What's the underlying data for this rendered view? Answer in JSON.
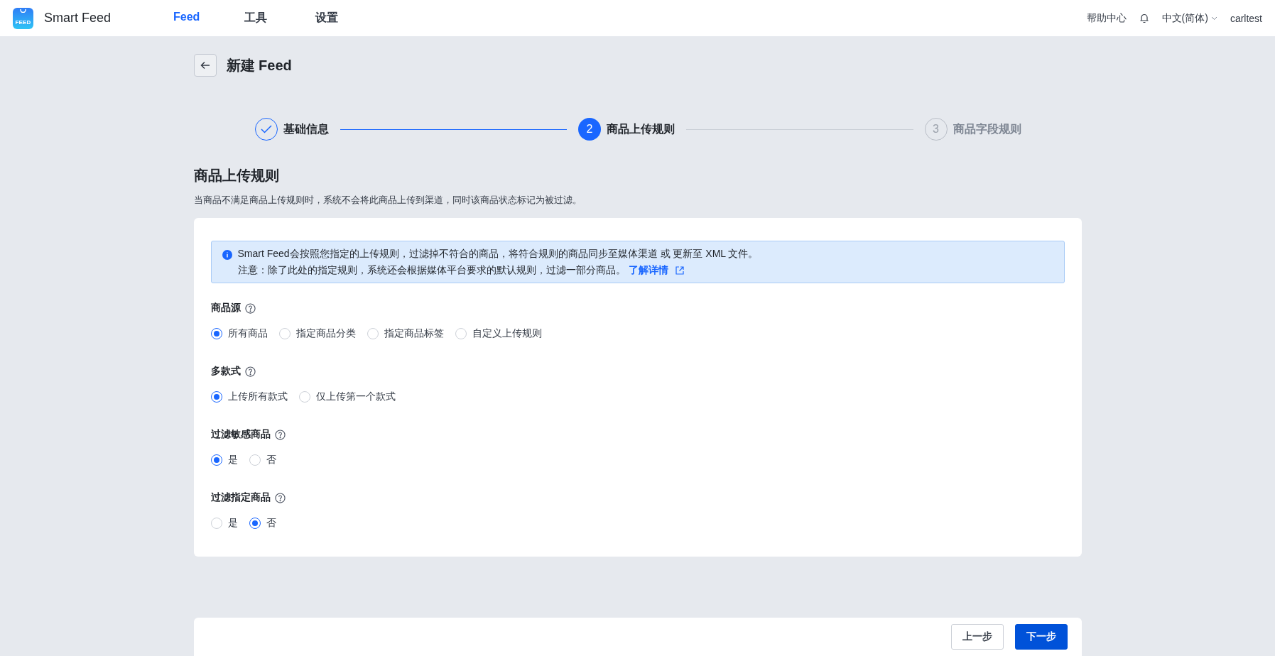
{
  "header": {
    "logo_text": "FEED",
    "app_name": "Smart Feed",
    "nav": [
      {
        "label": "Feed",
        "selected": true
      },
      {
        "label": "工具",
        "selected": false
      },
      {
        "label": "设置",
        "selected": false
      }
    ],
    "help": "帮助中心",
    "language": "中文(简体)",
    "user": "carltest"
  },
  "page": {
    "title": "新建 Feed"
  },
  "steps": [
    {
      "label": "基础信息",
      "kind": "done"
    },
    {
      "number": "2",
      "label": "商品上传规则",
      "kind": "current"
    },
    {
      "number": "3",
      "label": "商品字段规则",
      "kind": "pending"
    }
  ],
  "section": {
    "title": "商品上传规则",
    "description": "当商品不满足商品上传规则时，系统不会将此商品上传到渠道，同时该商品状态标记为被过滤。"
  },
  "notice": {
    "line_1": "Smart Feed会按照您指定的上传规则，过滤掉不符合的商品，将符合规则的商品同步至媒体渠道 或 更新至 XML 文件。",
    "line_2": "注意：除了此处的指定规则，系统还会根据媒体平台要求的默认规则，过滤一部分商品。",
    "link": "了解详情"
  },
  "fields": [
    {
      "label": "商品源",
      "options": [
        {
          "label": "所有商品",
          "selected": true
        },
        {
          "label": "指定商品分类",
          "selected": false
        },
        {
          "label": "指定商品标签",
          "selected": false
        },
        {
          "label": "自定义上传规则",
          "selected": false
        }
      ]
    },
    {
      "label": "多款式",
      "options": [
        {
          "label": "上传所有款式",
          "selected": true
        },
        {
          "label": "仅上传第一个款式",
          "selected": false
        }
      ]
    },
    {
      "label": "过滤敏感商品",
      "options": [
        {
          "label": "是",
          "selected": true
        },
        {
          "label": "否",
          "selected": false
        }
      ]
    },
    {
      "label": "过滤指定商品",
      "options": [
        {
          "label": "是",
          "selected": false
        },
        {
          "label": "否",
          "selected": true
        }
      ]
    }
  ],
  "footer": {
    "buttons": [
      {
        "label": "上一步",
        "kind": "secondary"
      },
      {
        "label": "下一步",
        "kind": "primary"
      }
    ]
  }
}
